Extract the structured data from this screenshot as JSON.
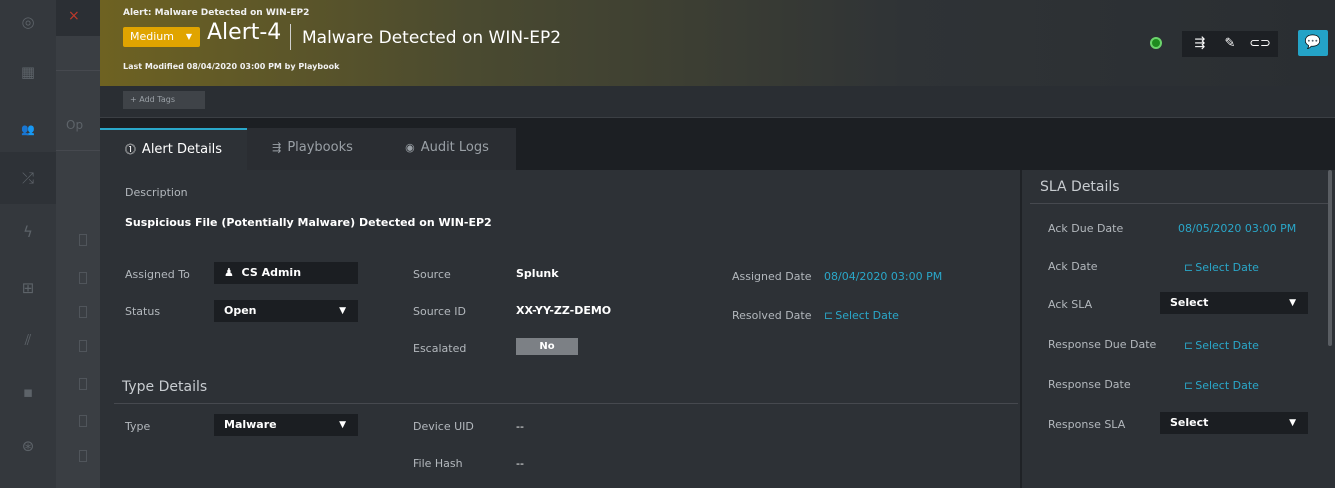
{
  "leftnav": {
    "icons": [
      "gear-icon",
      "grid-icon",
      "people-icon",
      "shuffle-icon",
      "bolt-icon",
      "briefcase-icon",
      "chart-icon",
      "apps-icon",
      "settings-icon"
    ]
  },
  "background": {
    "close": "×",
    "op_text": "Op"
  },
  "header": {
    "crumb": "Alert: Malware Detected on WIN-EP2",
    "severity": "Medium",
    "alert_id": "Alert-4",
    "alert_name": "Malware Detected on WIN-EP2",
    "modified": "Last Modified 08/04/2020 03:00 PM by Playbook",
    "status_color": "#1f8b1f",
    "accent": "#e0a400"
  },
  "tags": {
    "add_label": "+ Add Tags"
  },
  "tabs": [
    {
      "label": "Alert Details",
      "icon": "info-icon",
      "glyph": "⓵"
    },
    {
      "label": "Playbooks",
      "icon": "playbook-icon",
      "glyph": "⇶"
    },
    {
      "label": "Audit Logs",
      "icon": "eye-icon",
      "glyph": "◉"
    }
  ],
  "details": {
    "description_label": "Description",
    "description": "Suspicious File (Potentially Malware) Detected on WIN-EP2",
    "assigned_to_label": "Assigned To",
    "assigned_to": "CS Admin",
    "status_label": "Status",
    "status": "Open",
    "source_label": "Source",
    "source": "Splunk",
    "source_id_label": "Source ID",
    "source_id": "XX-YY-ZZ-DEMO",
    "escalated_label": "Escalated",
    "escalated": "No",
    "assigned_date_label": "Assigned Date",
    "assigned_date": "08/04/2020 03:00 PM",
    "resolved_date_label": "Resolved Date",
    "resolved_date": "Select Date"
  },
  "type_details": {
    "title": "Type Details",
    "type_label": "Type",
    "type": "Malware",
    "device_uid_label": "Device UID",
    "device_uid": "--",
    "file_hash_label": "File Hash",
    "file_hash": "--"
  },
  "sla": {
    "title": "SLA Details",
    "ack_due_label": "Ack Due Date",
    "ack_due": "08/05/2020 03:00 PM",
    "ack_date_label": "Ack Date",
    "ack_date": "Select Date",
    "ack_sla_label": "Ack SLA",
    "ack_sla": "Select",
    "resp_due_label": "Response Due Date",
    "resp_due": "Select Date",
    "resp_date_label": "Response Date",
    "resp_date": "Select Date",
    "resp_sla_label": "Response SLA",
    "resp_sla": "Select"
  }
}
